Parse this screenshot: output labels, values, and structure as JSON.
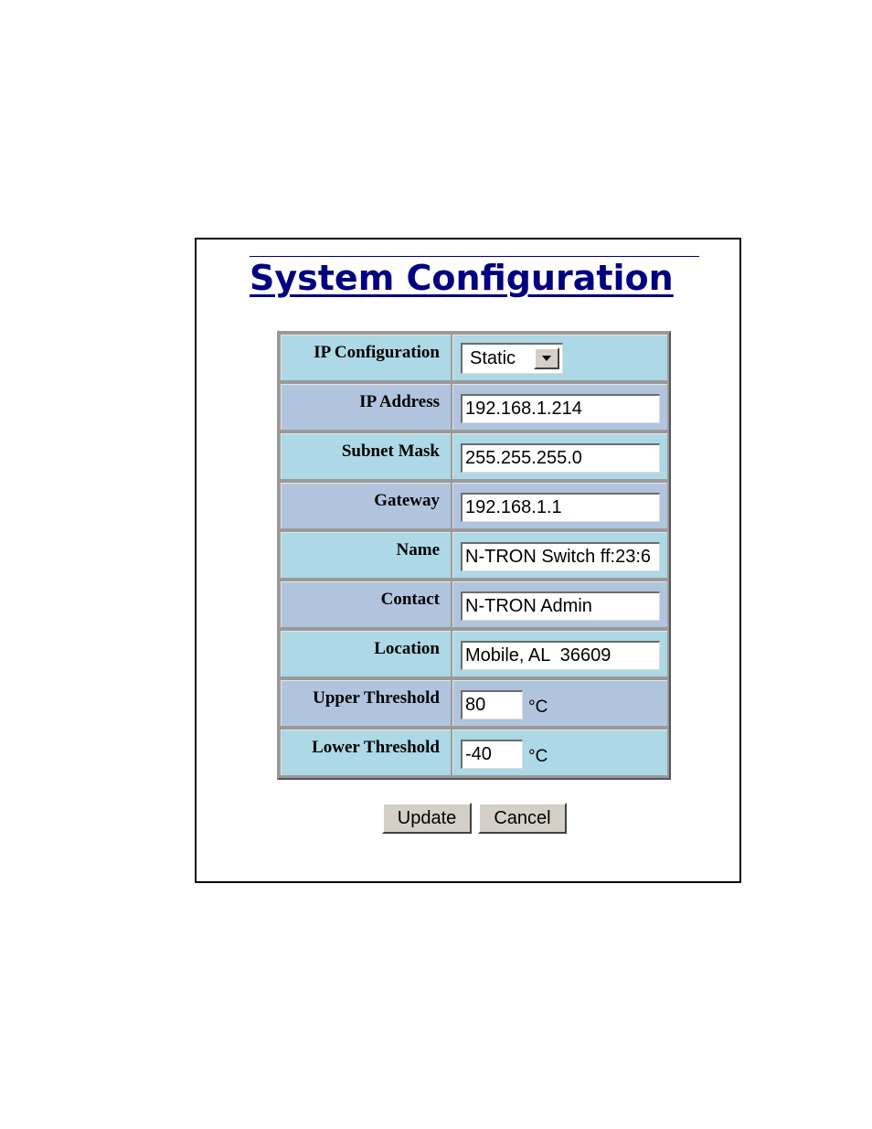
{
  "page": {
    "title": "System Configuration"
  },
  "form": {
    "rows": [
      {
        "label": "IP Configuration",
        "type": "select",
        "value": "Static"
      },
      {
        "label": "IP Address",
        "type": "text",
        "value": "192.168.1.214"
      },
      {
        "label": "Subnet Mask",
        "type": "text",
        "value": "255.255.255.0"
      },
      {
        "label": "Gateway",
        "type": "text",
        "value": "192.168.1.1"
      },
      {
        "label": "Name",
        "type": "text",
        "value": "N-TRON Switch ff:23:6"
      },
      {
        "label": "Contact",
        "type": "text",
        "value": "N-TRON Admin"
      },
      {
        "label": "Location",
        "type": "text",
        "value": "Mobile, AL  36609"
      },
      {
        "label": "Upper Threshold",
        "type": "text",
        "value": "80",
        "unit": "°C"
      },
      {
        "label": "Lower Threshold",
        "type": "text",
        "value": "-40",
        "unit": "°C"
      }
    ]
  },
  "buttons": {
    "update_label": "Update",
    "cancel_label": "Cancel"
  },
  "colors": {
    "title": "#000080",
    "row_light": "#add8e6",
    "row_dark": "#b0c4de"
  },
  "icons": {
    "select_arrow": "chevron-down-icon"
  }
}
